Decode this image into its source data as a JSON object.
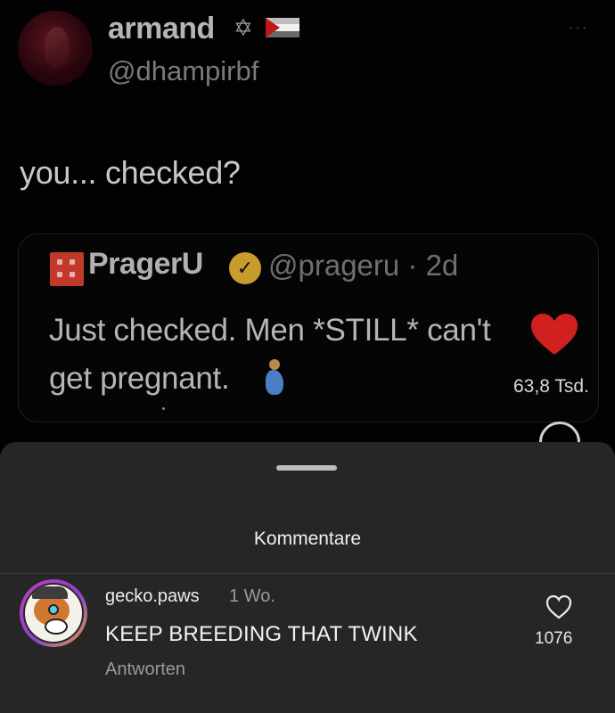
{
  "tweet": {
    "author_name": "armand",
    "author_handle": "@dhampirbf",
    "badge_star": "✡",
    "more": "···",
    "text": "you... checked?",
    "quote": {
      "name": "PragerU",
      "handle_time": "@prageru · 2d",
      "line1": "Just checked. Men *STILL* can't",
      "line2": "get pregnant.",
      "likes": "63,8 Tsd.",
      "heart_color": "#d21f1f"
    }
  },
  "sheet": {
    "title": "Kommentare",
    "comment": {
      "username": "gecko.paws",
      "time": "1 Wo.",
      "text": "KEEP BREEDING THAT TWINK",
      "reply_label": "Antworten",
      "likes": "1076"
    }
  }
}
